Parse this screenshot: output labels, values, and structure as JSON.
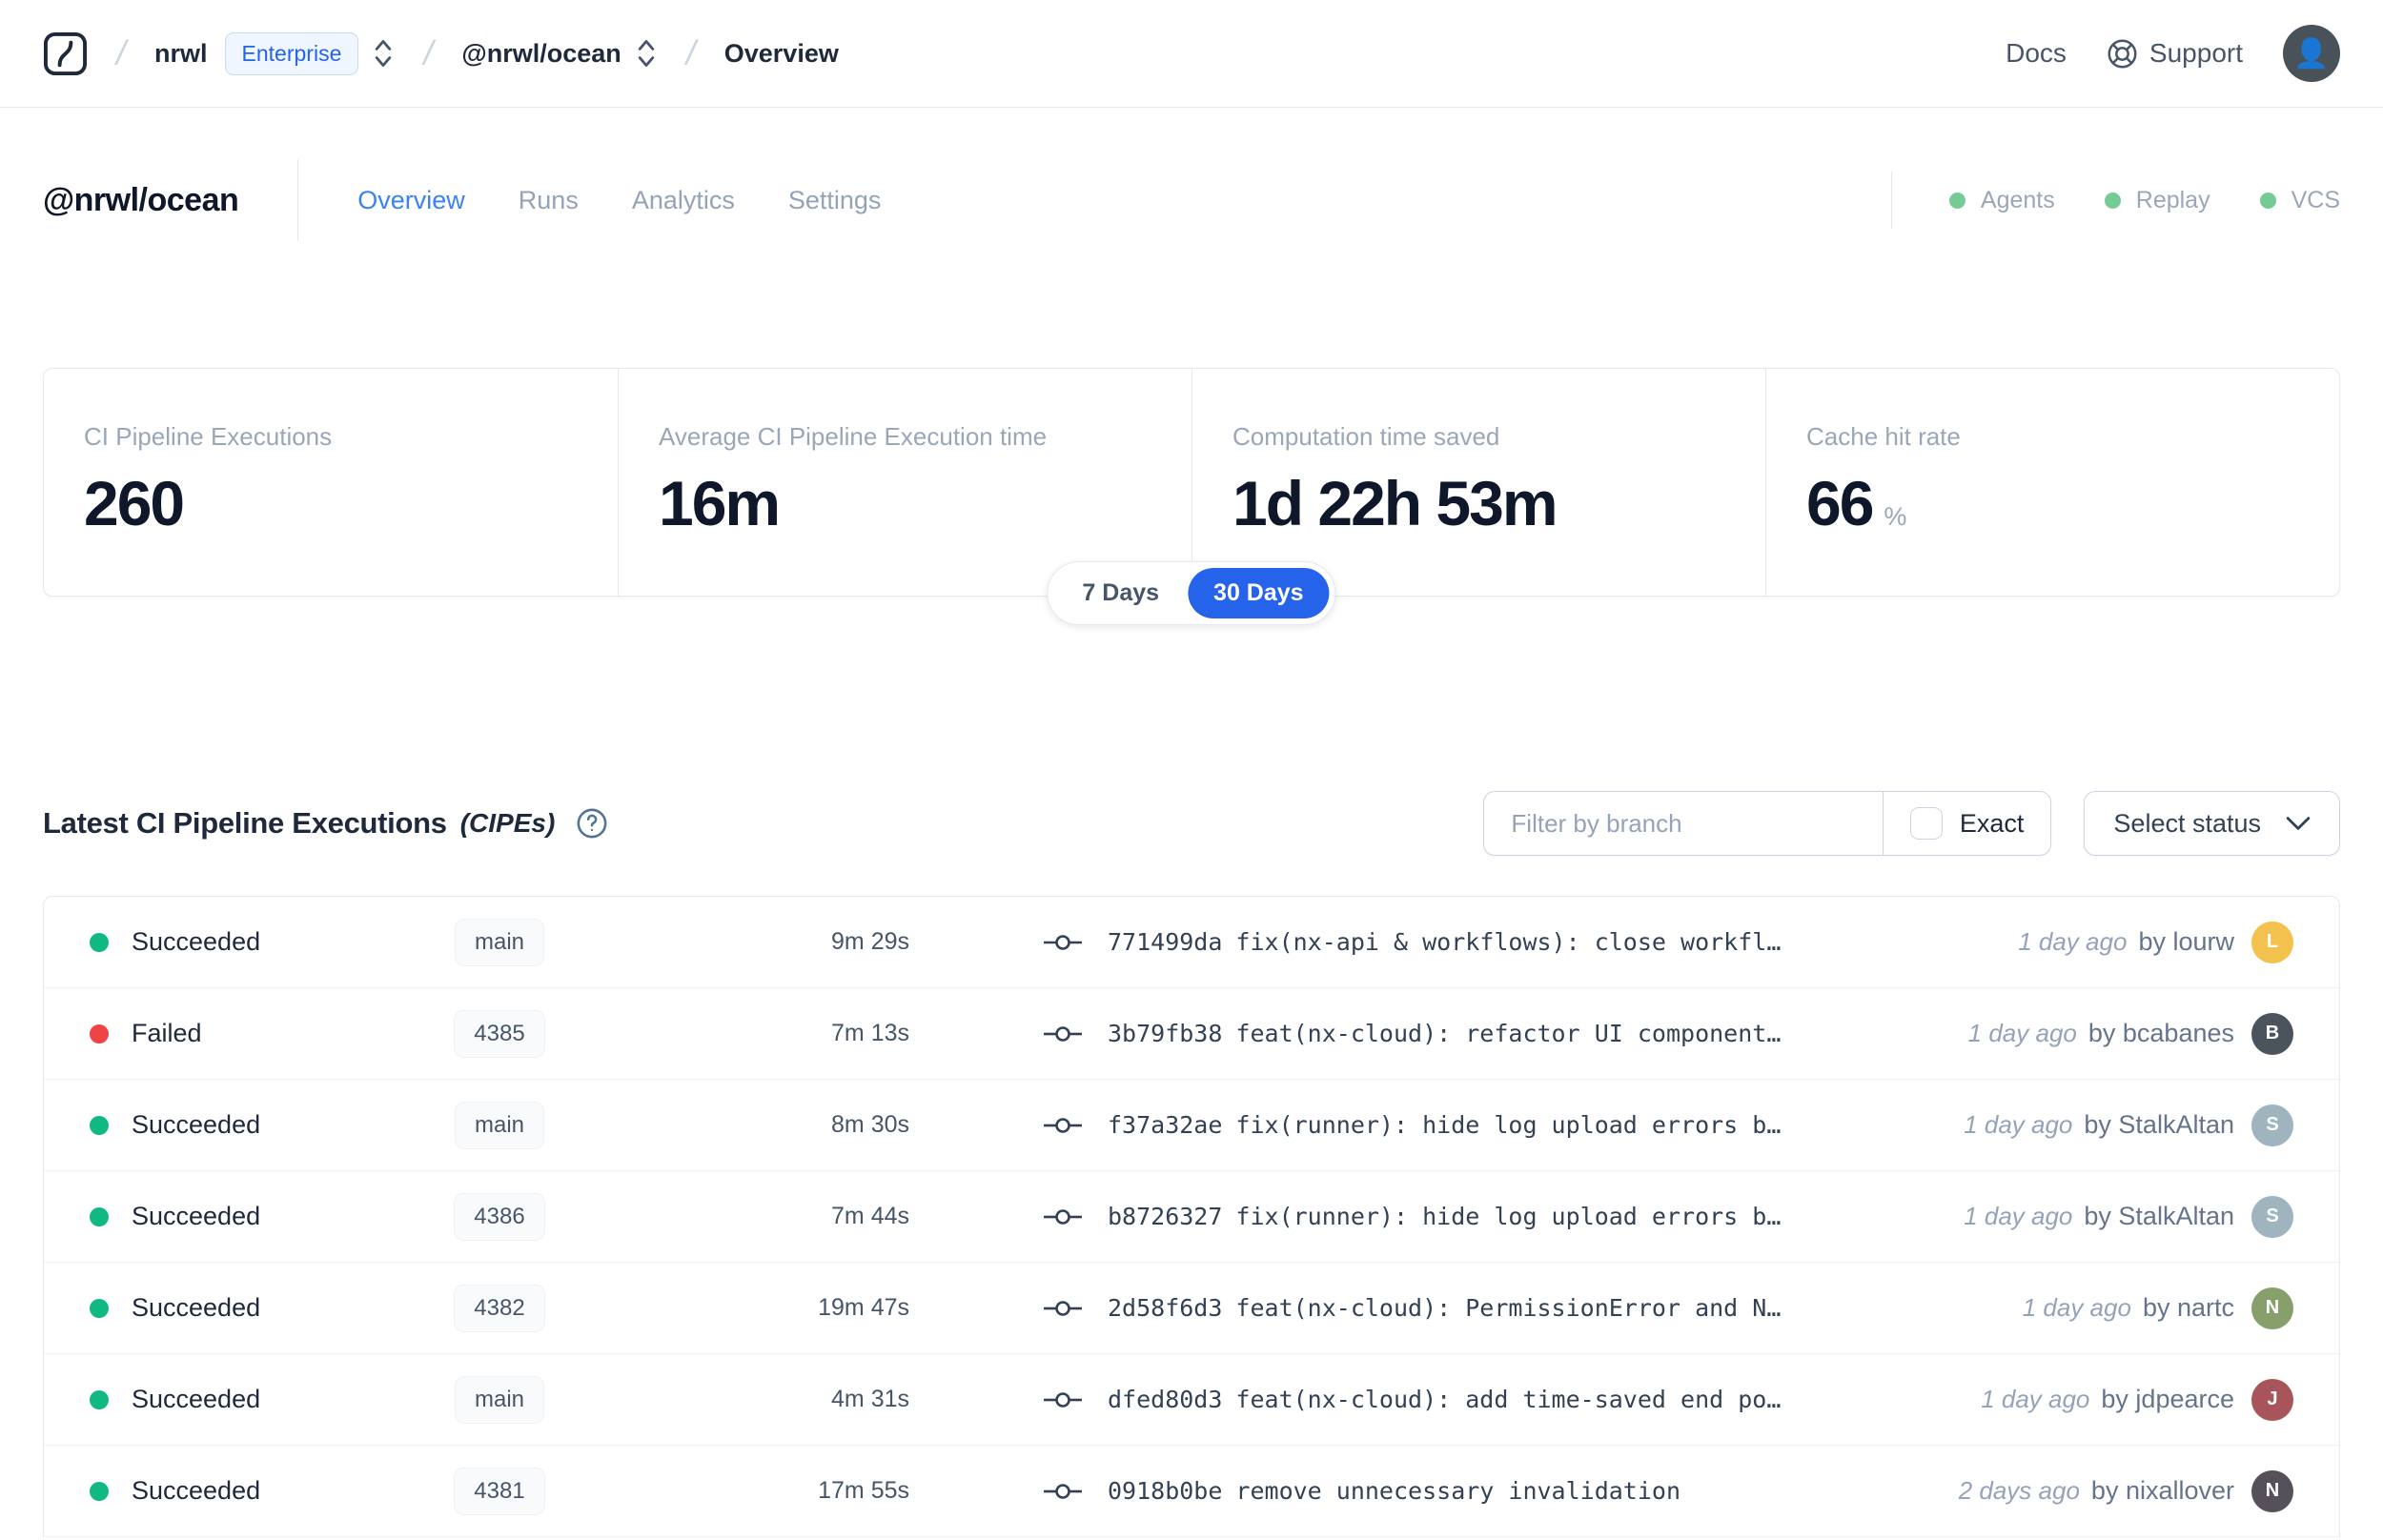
{
  "nav": {
    "breadcrumb": {
      "org": "nrwl",
      "org_badge": "Enterprise",
      "workspace": "@nrwl/ocean",
      "page": "Overview"
    },
    "docs_label": "Docs",
    "support_label": "Support"
  },
  "header": {
    "title": "@nrwl/ocean",
    "tabs": [
      {
        "label": "Overview",
        "active": true
      },
      {
        "label": "Runs",
        "active": false
      },
      {
        "label": "Analytics",
        "active": false
      },
      {
        "label": "Settings",
        "active": false
      }
    ],
    "status_indicators": [
      "Agents",
      "Replay",
      "VCS"
    ]
  },
  "stats": {
    "cards": [
      {
        "label": "CI Pipeline Executions",
        "value": "260"
      },
      {
        "label": "Average CI Pipeline Execution time",
        "value": "16m"
      },
      {
        "label": "Computation time saved",
        "value": "1d 22h 53m"
      },
      {
        "label": "Cache hit rate",
        "value": "66",
        "suffix": "%"
      }
    ],
    "period_toggle": {
      "options": [
        "7 Days",
        "30 Days"
      ],
      "selected": "30 Days"
    }
  },
  "cipe_section": {
    "title": "Latest CI Pipeline Executions",
    "title_suffix": "(CIPEs)",
    "filter": {
      "branch_placeholder": "Filter by branch",
      "exact_label": "Exact",
      "status_button": "Select status"
    },
    "rows": [
      {
        "status": "Succeeded",
        "status_color": "#10b981",
        "branch": "main",
        "duration": "9m 29s",
        "commit_hash": "771499da",
        "commit_message": "fix(nx-api & workflows): close workfl…",
        "time_ago": "1 day ago",
        "author": "by lourw",
        "avatar_color": "#f2c14e",
        "avatar_initial": "L"
      },
      {
        "status": "Failed",
        "status_color": "#ef4444",
        "branch": "4385",
        "duration": "7m 13s",
        "commit_hash": "3b79fb38",
        "commit_message": "feat(nx-cloud): refactor UI component…",
        "time_ago": "1 day ago",
        "author": "by bcabanes",
        "avatar_color": "#4b545c",
        "avatar_initial": "B"
      },
      {
        "status": "Succeeded",
        "status_color": "#10b981",
        "branch": "main",
        "duration": "8m 30s",
        "commit_hash": "f37a32ae",
        "commit_message": "fix(runner): hide log upload errors b…",
        "time_ago": "1 day ago",
        "author": "by StalkAltan",
        "avatar_color": "#9fb4bf",
        "avatar_initial": "S"
      },
      {
        "status": "Succeeded",
        "status_color": "#10b981",
        "branch": "4386",
        "duration": "7m 44s",
        "commit_hash": "b8726327",
        "commit_message": "fix(runner): hide log upload errors b…",
        "time_ago": "1 day ago",
        "author": "by StalkAltan",
        "avatar_color": "#9fb4bf",
        "avatar_initial": "S"
      },
      {
        "status": "Succeeded",
        "status_color": "#10b981",
        "branch": "4382",
        "duration": "19m 47s",
        "commit_hash": "2d58f6d3",
        "commit_message": "feat(nx-cloud): PermissionError and N…",
        "time_ago": "1 day ago",
        "author": "by nartc",
        "avatar_color": "#87a06b",
        "avatar_initial": "N"
      },
      {
        "status": "Succeeded",
        "status_color": "#10b981",
        "branch": "main",
        "duration": "4m 31s",
        "commit_hash": "dfed80d3",
        "commit_message": "feat(nx-cloud): add time-saved end po…",
        "time_ago": "1 day ago",
        "author": "by jdpearce",
        "avatar_color": "#a8545b",
        "avatar_initial": "J"
      },
      {
        "status": "Succeeded",
        "status_color": "#10b981",
        "branch": "4381",
        "duration": "17m 55s",
        "commit_hash": "0918b0be",
        "commit_message": "remove unnecessary invalidation",
        "time_ago": "2 days ago",
        "author": "by nixallover",
        "avatar_color": "#555059",
        "avatar_initial": "N"
      }
    ]
  },
  "icons": {
    "logo": "nx-cloud-logo",
    "breadcrumb_switcher": "chevron-up-down",
    "support": "lifebuoy",
    "help": "question-circle",
    "commit": "git-commit",
    "select_chevron": "chevron-down"
  },
  "colors": {
    "accent_blue": "#2563eb",
    "active_tab_blue": "#3b82f6",
    "success_green": "#10b981",
    "failed_red": "#ef4444",
    "indicator_green": "#74cb96",
    "border": "#e5e9f0"
  }
}
